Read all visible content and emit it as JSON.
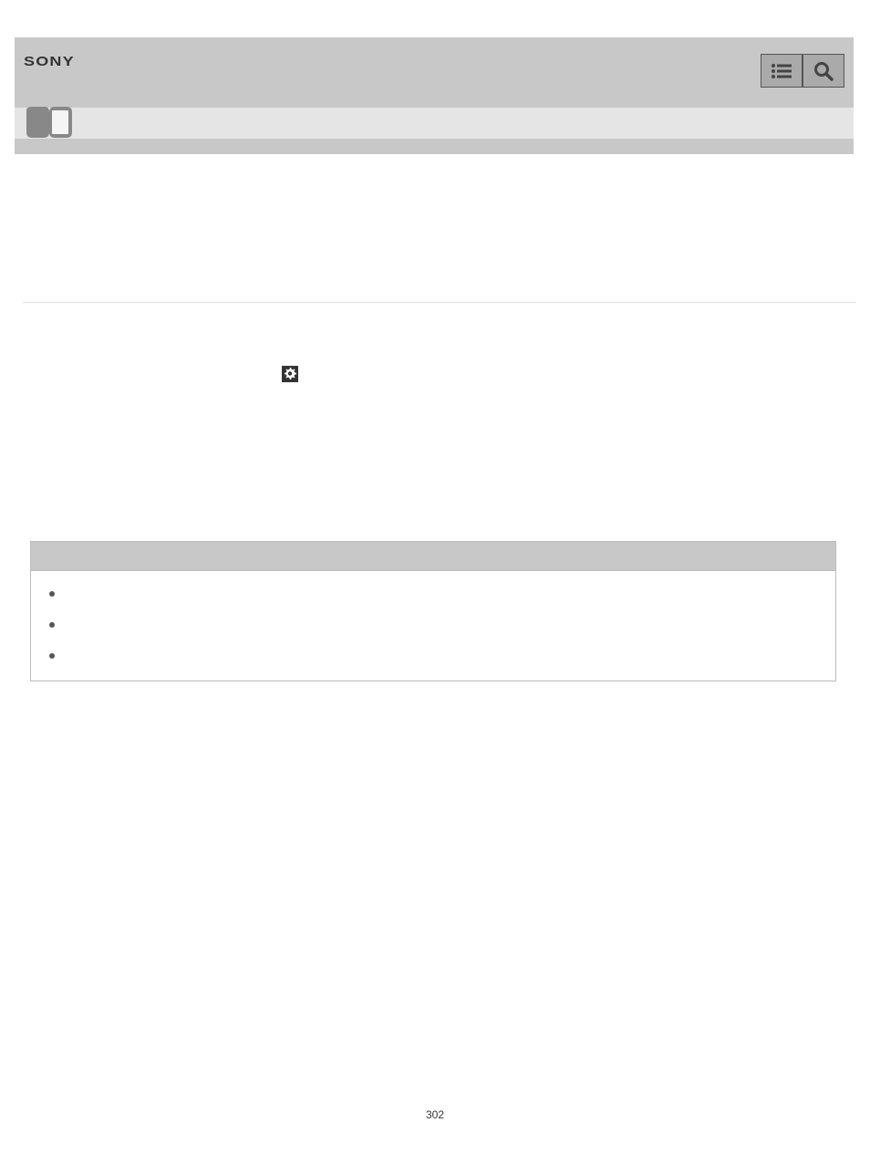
{
  "header": {
    "logo": "SONY"
  },
  "page_number": "302"
}
